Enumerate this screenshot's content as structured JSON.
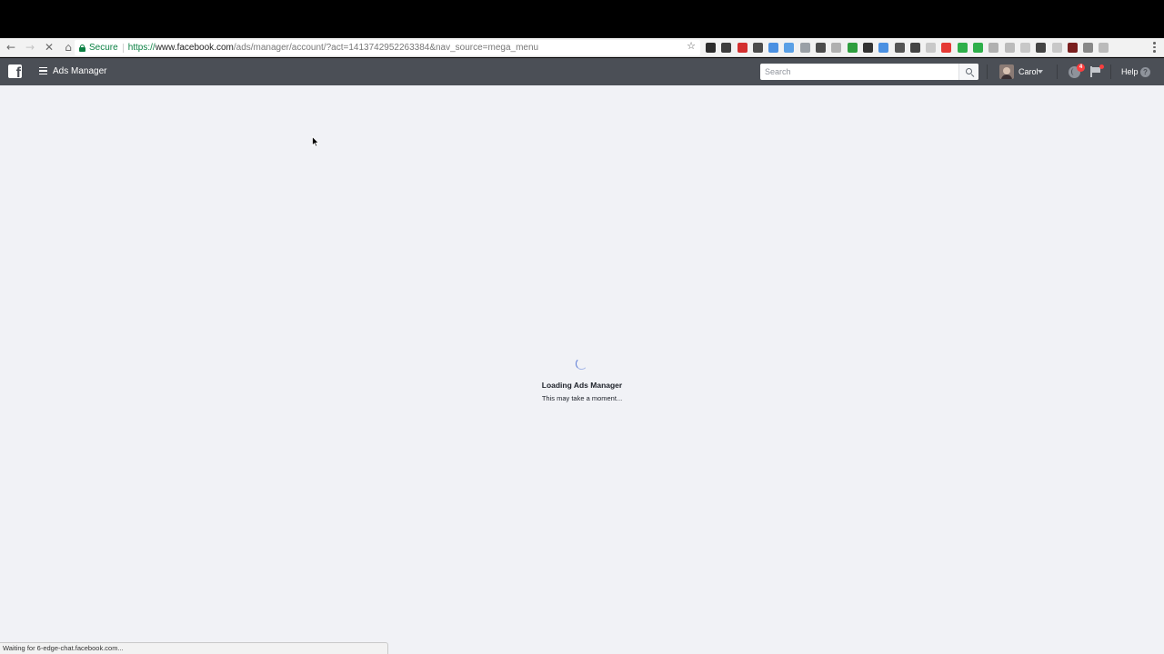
{
  "browser": {
    "secure_label": "Secure",
    "url_origin": "https://",
    "url_host": "www.facebook.com",
    "url_path": "/ads/manager/account/?act=1413742952263384&nav_source=mega_menu",
    "status_text": "Waiting for 6-edge-chat.facebook.com...",
    "back_icon": "←",
    "forward_icon": "→",
    "stop_icon": "✕",
    "home_icon": "⌂",
    "star_icon": "☆",
    "extension_colors": [
      "#2b2b2b",
      "#3d3d3d",
      "#d32f2f",
      "#4c4c4c",
      "#4a90e2",
      "#5aa0e6",
      "#9aa0a6",
      "#4c4c4c",
      "#b0b0b0",
      "#2e9e3e",
      "#333333",
      "#4a90e2",
      "#555555",
      "#444444",
      "#c8c8c8",
      "#e53935",
      "#2eaf4a",
      "#2eaf4a",
      "#b0b0b0",
      "#bbbbbb",
      "#c8c8c8",
      "#444444",
      "#c8c8c8",
      "#7a1f1f",
      "#888888",
      "#bbbbbb"
    ]
  },
  "fb_header": {
    "app_title": "Ads Manager",
    "search_placeholder": "Search",
    "user_name": "Carol",
    "notification_count": "4",
    "help_label": "Help",
    "help_icon": "?"
  },
  "main": {
    "loading_title": "Loading Ads Manager",
    "loading_subtitle": "This may take a moment..."
  },
  "colors": {
    "fb_bar": "#4b4f56",
    "background": "#f1f2f6",
    "secure_green": "#0b8043"
  }
}
